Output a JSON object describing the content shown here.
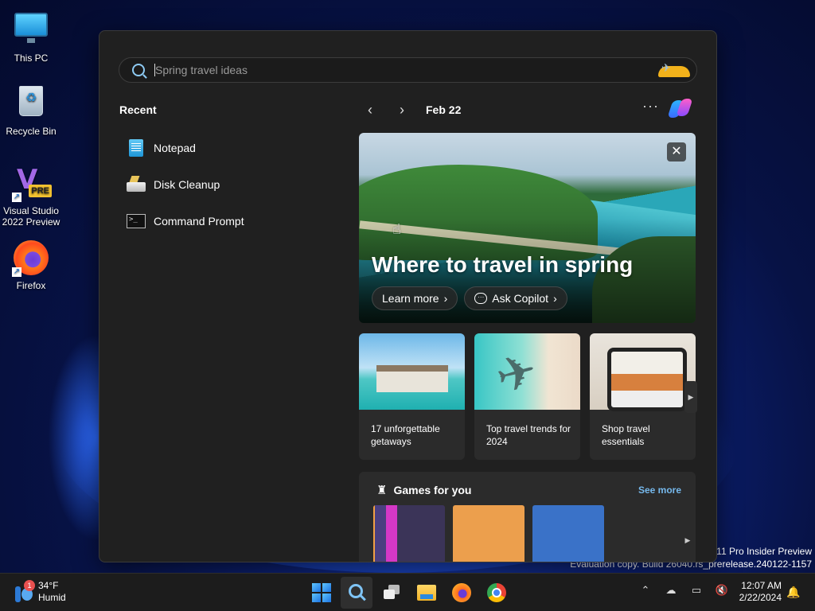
{
  "desktop": {
    "icons": [
      {
        "label": "This PC"
      },
      {
        "label": "Recycle Bin"
      },
      {
        "label": "Visual Studio 2022 Preview",
        "badge": "PRE"
      },
      {
        "label": "Firefox"
      }
    ]
  },
  "search": {
    "placeholder": "Spring travel ideas"
  },
  "recent": {
    "title": "Recent",
    "items": [
      {
        "label": "Notepad",
        "icon": "notepad-icon"
      },
      {
        "label": "Disk Cleanup",
        "icon": "disk-cleanup-icon"
      },
      {
        "label": "Command Prompt",
        "icon": "command-prompt-icon"
      }
    ]
  },
  "feed": {
    "date": "Feb 22",
    "prev_icon": "‹",
    "next_icon": "›",
    "more_icon": "···",
    "hero": {
      "headline": "Where to travel in spring",
      "learn_more": "Learn more",
      "ask_copilot": "Ask Copilot",
      "close": "✕"
    },
    "cards": [
      {
        "title": "17 unforgettable getaways"
      },
      {
        "title": "Top travel trends for 2024"
      },
      {
        "title": "Shop travel essentials"
      }
    ],
    "games": {
      "title": "Games for you",
      "see_more": "See more"
    }
  },
  "watermark": {
    "line1": "s 11 Pro Insider Preview",
    "line2": "Evaluation copy. Build 26040.rs_prerelease.240122-1157"
  },
  "taskbar": {
    "weather": {
      "temp": "34°F",
      "condition": "Humid",
      "badge": "1"
    },
    "clock": {
      "time": "12:07 AM",
      "date": "2/22/2024"
    }
  }
}
